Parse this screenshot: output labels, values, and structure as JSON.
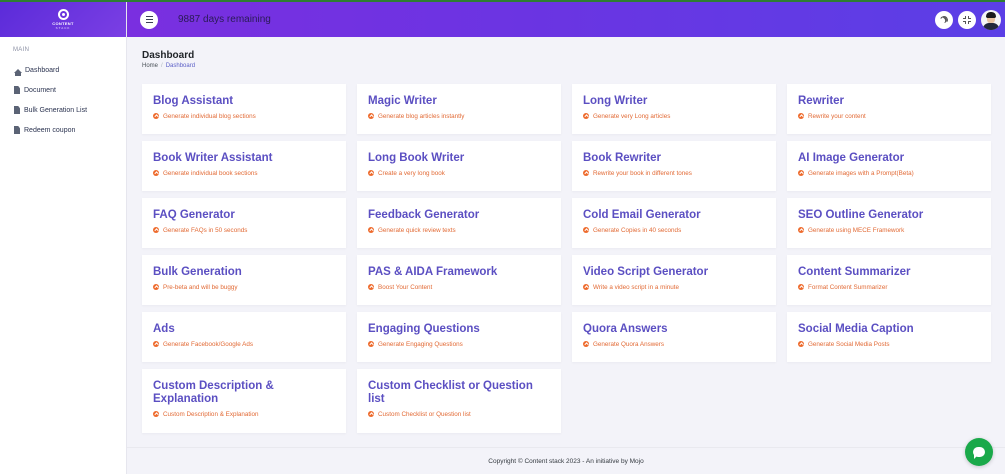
{
  "app": {
    "logo_text": "CONTENT",
    "logo_sub": "STACK"
  },
  "header": {
    "days_remaining": "9887 days remaining"
  },
  "sidebar": {
    "section_title": "MAIN",
    "items": [
      {
        "label": "Dashboard",
        "icon": "home-icon"
      },
      {
        "label": "Document",
        "icon": "file-icon"
      },
      {
        "label": "Bulk Generation List",
        "icon": "file-icon"
      },
      {
        "label": "Redeem coupon",
        "icon": "file-icon"
      }
    ]
  },
  "page": {
    "title": "Dashboard",
    "breadcrumb": {
      "home": "Home",
      "separator": "/",
      "current": "Dashboard"
    }
  },
  "cards": [
    {
      "title": "Blog Assistant",
      "subtitle": "Generate individual blog sections"
    },
    {
      "title": "Magic Writer",
      "subtitle": "Generate blog articles instantly"
    },
    {
      "title": "Long Writer",
      "subtitle": "Generate very Long articles"
    },
    {
      "title": "Rewriter",
      "subtitle": "Rewrite your content"
    },
    {
      "title": "Book Writer Assistant",
      "subtitle": "Generate individual book sections"
    },
    {
      "title": "Long Book Writer",
      "subtitle": "Create a very long book"
    },
    {
      "title": "Book Rewriter",
      "subtitle": "Rewrite your book in different tones"
    },
    {
      "title": "AI Image Generator",
      "subtitle": "Generate images with a Prompt(Beta)"
    },
    {
      "title": "FAQ Generator",
      "subtitle": "Generate FAQs in 50 seconds"
    },
    {
      "title": "Feedback Generator",
      "subtitle": "Generate quick review texts"
    },
    {
      "title": "Cold Email Generator",
      "subtitle": "Generate Copies in 40 seconds"
    },
    {
      "title": "SEO Outline Generator",
      "subtitle": "Generate using MECE Framework"
    },
    {
      "title": "Bulk Generation",
      "subtitle": "Pre-beta and will be buggy"
    },
    {
      "title": "PAS & AIDA Framework",
      "subtitle": "Boost Your Content"
    },
    {
      "title": "Video Script Generator",
      "subtitle": "Write a video script in a minute"
    },
    {
      "title": "Content Summarizer",
      "subtitle": "Format Content Summarizer"
    },
    {
      "title": "Ads",
      "subtitle": "Generate Facebook/Google Ads"
    },
    {
      "title": "Engaging Questions",
      "subtitle": "Generate Engaging Questions"
    },
    {
      "title": "Quora Answers",
      "subtitle": "Generate Quora Answers"
    },
    {
      "title": "Social Media Caption",
      "subtitle": "Generate Social Media Posts"
    },
    {
      "title": "Custom Description & Explanation",
      "subtitle": "Custom Description & Explanation"
    },
    {
      "title": "Custom Checklist or Question list",
      "subtitle": "Custom Checklist or Question list"
    }
  ],
  "footer": {
    "text": "Copyright © Content stack 2023 - An initiative by Mojo"
  },
  "colors": {
    "header_gradient_start": "#7a2fe0",
    "header_gradient_end": "#5b3fe6",
    "card_title": "#5b4fc2",
    "card_subtitle": "#e26a35",
    "chat_button": "#1aa94a"
  }
}
